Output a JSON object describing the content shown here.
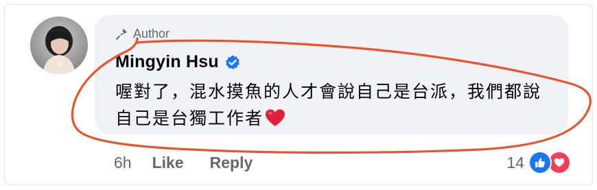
{
  "comment": {
    "badge_label": "Author",
    "author_name": "Mingyin Hsu",
    "text": "喔對了，混水摸魚的人才會說自己是台派，我們都說自己是台獨工作者",
    "timestamp": "6h",
    "like_label": "Like",
    "reply_label": "Reply",
    "reaction_count": "14"
  },
  "icons": {
    "badge": "pen-nib-icon",
    "verified": "verified-badge-icon",
    "emoji": "red-heart-icon",
    "reaction_1": "like-thumb-icon",
    "reaction_2": "love-heart-icon"
  },
  "colors": {
    "bubble": "#f0f2f5",
    "text": "#050505",
    "muted": "#65676b",
    "verified": "#1877f2",
    "like_reaction": "#1877f2",
    "love_reaction": "#f33e58",
    "annotation": "#e8542b"
  }
}
